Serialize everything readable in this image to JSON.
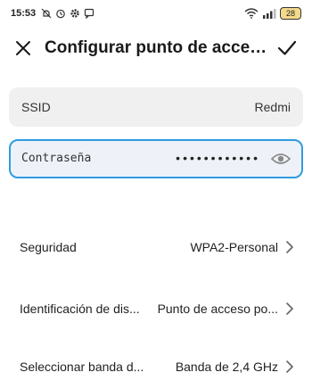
{
  "status_bar": {
    "time": "15:53",
    "battery": "28"
  },
  "header": {
    "title": "Configurar punto de acceso po..."
  },
  "ssid": {
    "label": "SSID",
    "value": "Redmi"
  },
  "password": {
    "label": "Contraseña",
    "masked_value": "••••••••••••"
  },
  "settings": [
    {
      "label": "Seguridad",
      "value": "WPA2-Personal"
    },
    {
      "label": "Identificación de dis...",
      "value": "Punto de acceso po..."
    },
    {
      "label": "Seleccionar banda d...",
      "value": "Banda de 2,4 GHz"
    }
  ],
  "colors": {
    "accent": "#2f9ce0",
    "field_background": "#f0f0f0",
    "focused_field_background": "#eef2f8"
  },
  "icons": [
    "mute-icon",
    "alarm-icon",
    "gear-icon",
    "chat-icon",
    "wifi-icon",
    "signal-icon",
    "battery-icon",
    "close-icon",
    "check-icon",
    "eye-icon",
    "chevron-right-icon"
  ]
}
